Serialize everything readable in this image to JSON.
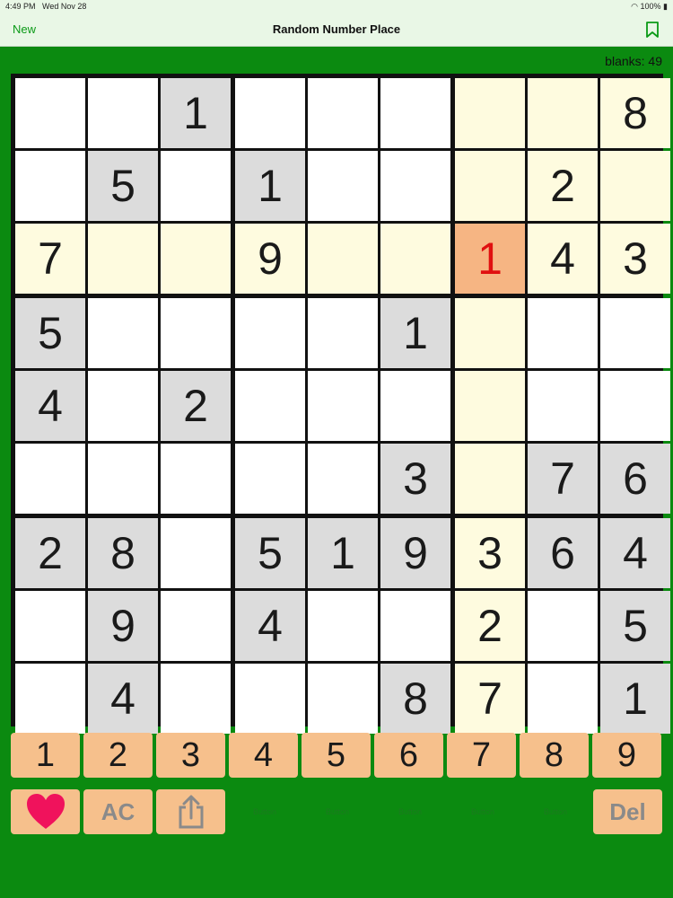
{
  "status_bar": {
    "time": "4:49 PM",
    "date": "Wed Nov 28",
    "battery": "100%"
  },
  "nav": {
    "new_label": "New",
    "title": "Random Number Place"
  },
  "blanks_label": "blanks: 49",
  "board": [
    [
      {
        "v": "",
        "t": "empty"
      },
      {
        "v": "",
        "t": "empty"
      },
      {
        "v": "1",
        "t": "given"
      },
      {
        "v": "",
        "t": "empty"
      },
      {
        "v": "",
        "t": "empty"
      },
      {
        "v": "",
        "t": "empty"
      },
      {
        "v": "",
        "t": "hl"
      },
      {
        "v": "",
        "t": "hl"
      },
      {
        "v": "8",
        "t": "hl"
      }
    ],
    [
      {
        "v": "",
        "t": "empty"
      },
      {
        "v": "5",
        "t": "given"
      },
      {
        "v": "",
        "t": "empty"
      },
      {
        "v": "1",
        "t": "given"
      },
      {
        "v": "",
        "t": "empty"
      },
      {
        "v": "",
        "t": "empty"
      },
      {
        "v": "",
        "t": "hl"
      },
      {
        "v": "2",
        "t": "hl"
      },
      {
        "v": "",
        "t": "hl"
      }
    ],
    [
      {
        "v": "7",
        "t": "hl"
      },
      {
        "v": "",
        "t": "hl"
      },
      {
        "v": "",
        "t": "hl"
      },
      {
        "v": "9",
        "t": "hl"
      },
      {
        "v": "",
        "t": "hl"
      },
      {
        "v": "",
        "t": "hl"
      },
      {
        "v": "1",
        "t": "sel"
      },
      {
        "v": "4",
        "t": "hl"
      },
      {
        "v": "3",
        "t": "hl"
      }
    ],
    [
      {
        "v": "5",
        "t": "given"
      },
      {
        "v": "",
        "t": "empty"
      },
      {
        "v": "",
        "t": "empty"
      },
      {
        "v": "",
        "t": "empty"
      },
      {
        "v": "",
        "t": "empty"
      },
      {
        "v": "1",
        "t": "given"
      },
      {
        "v": "",
        "t": "hl"
      },
      {
        "v": "",
        "t": "empty"
      },
      {
        "v": "",
        "t": "empty"
      }
    ],
    [
      {
        "v": "4",
        "t": "given"
      },
      {
        "v": "",
        "t": "empty"
      },
      {
        "v": "2",
        "t": "given"
      },
      {
        "v": "",
        "t": "empty"
      },
      {
        "v": "",
        "t": "empty"
      },
      {
        "v": "",
        "t": "empty"
      },
      {
        "v": "",
        "t": "hl"
      },
      {
        "v": "",
        "t": "empty"
      },
      {
        "v": "",
        "t": "empty"
      }
    ],
    [
      {
        "v": "",
        "t": "empty"
      },
      {
        "v": "",
        "t": "empty"
      },
      {
        "v": "",
        "t": "empty"
      },
      {
        "v": "",
        "t": "empty"
      },
      {
        "v": "",
        "t": "empty"
      },
      {
        "v": "3",
        "t": "given"
      },
      {
        "v": "",
        "t": "hl"
      },
      {
        "v": "7",
        "t": "given"
      },
      {
        "v": "6",
        "t": "given"
      }
    ],
    [
      {
        "v": "2",
        "t": "given"
      },
      {
        "v": "8",
        "t": "given"
      },
      {
        "v": "",
        "t": "empty"
      },
      {
        "v": "5",
        "t": "given"
      },
      {
        "v": "1",
        "t": "given"
      },
      {
        "v": "9",
        "t": "given"
      },
      {
        "v": "3",
        "t": "hl"
      },
      {
        "v": "6",
        "t": "given"
      },
      {
        "v": "4",
        "t": "given"
      }
    ],
    [
      {
        "v": "",
        "t": "empty"
      },
      {
        "v": "9",
        "t": "given"
      },
      {
        "v": "",
        "t": "empty"
      },
      {
        "v": "4",
        "t": "given"
      },
      {
        "v": "",
        "t": "empty"
      },
      {
        "v": "",
        "t": "empty"
      },
      {
        "v": "2",
        "t": "hl"
      },
      {
        "v": "",
        "t": "empty"
      },
      {
        "v": "5",
        "t": "given"
      }
    ],
    [
      {
        "v": "",
        "t": "empty"
      },
      {
        "v": "4",
        "t": "given"
      },
      {
        "v": "",
        "t": "empty"
      },
      {
        "v": "",
        "t": "empty"
      },
      {
        "v": "",
        "t": "empty"
      },
      {
        "v": "8",
        "t": "given"
      },
      {
        "v": "7",
        "t": "hl"
      },
      {
        "v": "",
        "t": "empty"
      },
      {
        "v": "1",
        "t": "given"
      }
    ]
  ],
  "number_keys": [
    "1",
    "2",
    "3",
    "4",
    "5",
    "6",
    "7",
    "8",
    "9"
  ],
  "actions": {
    "heart_icon": "heart-icon",
    "ac_label": "AC",
    "share_icon": "share-icon",
    "del_label": "Del",
    "placeholder_labels": [
      "Button",
      "Button",
      "Button",
      "Button",
      "Button"
    ]
  },
  "colors": {
    "background": "#0b8a10",
    "given_cell": "#dcdcdc",
    "highlight_cell": "#fefbdf",
    "selected_cell": "#f6b583",
    "selected_digit": "#e01010",
    "key": "#f6c08c",
    "heart": "#f0125c",
    "accent": "#0a9a16"
  }
}
